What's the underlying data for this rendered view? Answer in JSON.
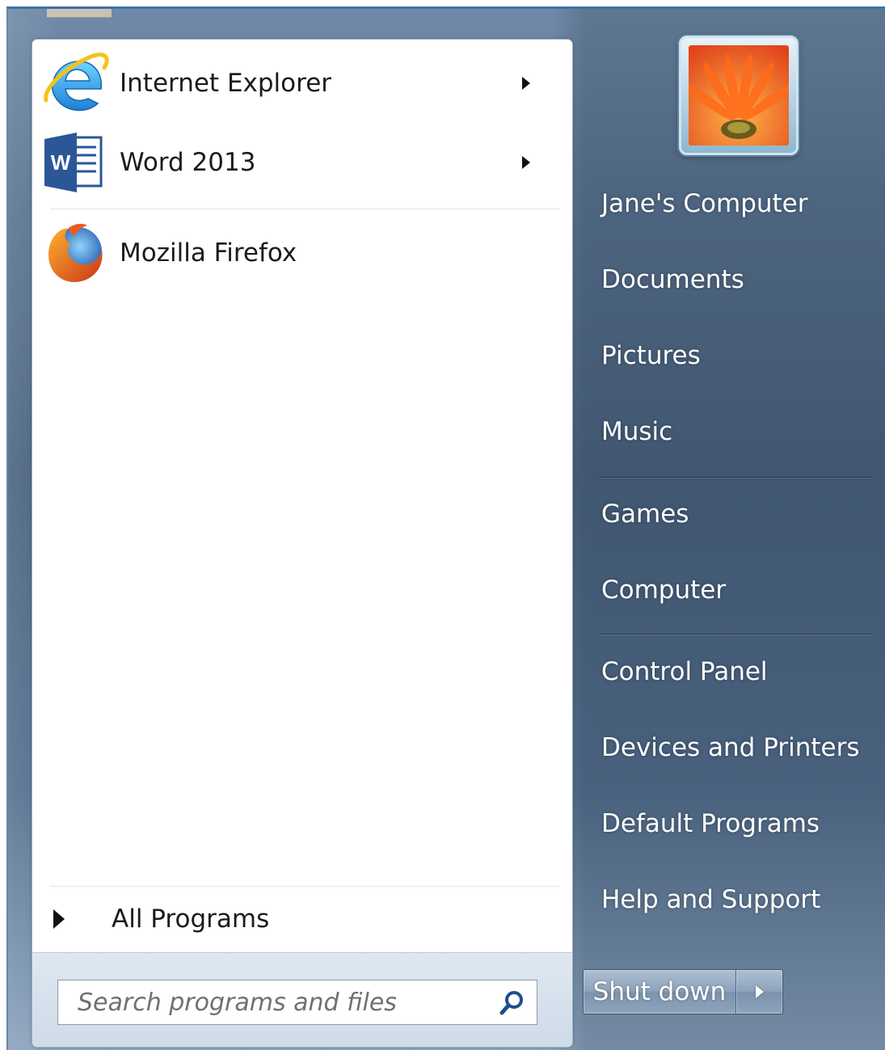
{
  "start_menu": {
    "pinned_programs": [
      {
        "label": "Internet Explorer",
        "icon": "internet-explorer-icon",
        "has_submenu": true
      },
      {
        "label": "Word 2013",
        "icon": "word-icon",
        "has_submenu": true
      }
    ],
    "recent_programs": [
      {
        "label": "Mozilla Firefox",
        "icon": "firefox-icon",
        "has_submenu": false
      }
    ],
    "all_programs_label": "All Programs",
    "search": {
      "placeholder": "Search programs and files",
      "value": ""
    },
    "word_icon_letter": "W"
  },
  "user": {
    "avatar_icon": "flower-avatar-icon"
  },
  "right_panel": {
    "items": [
      "Jane's Computer",
      "Documents",
      "Pictures",
      "Music",
      "Games",
      "Computer",
      "Control Panel",
      "Devices and Printers",
      "Default Programs",
      "Help and Support"
    ]
  },
  "shutdown": {
    "label": "Shut down"
  },
  "colors": {
    "accent": "#3f6fa8",
    "panel_text": "#ffffff",
    "program_text": "#1b1b1b"
  }
}
